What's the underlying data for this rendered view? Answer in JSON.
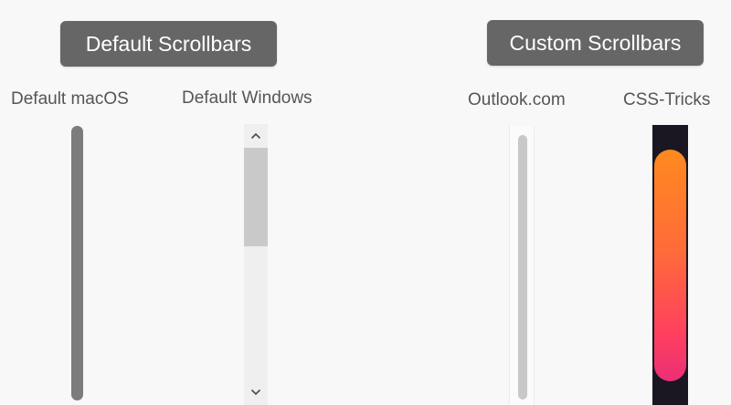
{
  "headings": {
    "default": "Default Scrollbars",
    "custom": "Custom Scrollbars"
  },
  "columns": {
    "macos": "Default macOS",
    "windows": "Default Windows",
    "outlook": "Outlook.com",
    "csstricks": "CSS-Tricks"
  },
  "icons": {
    "windows_up": "chevron-up-icon",
    "windows_down": "chevron-down-icon"
  },
  "colors": {
    "heading_bg": "#666666",
    "macos_thumb": "#7c7c7c",
    "windows_track": "#efefef",
    "windows_thumb": "#c9c9c9",
    "outlook_thumb": "#c8c8c8",
    "csstricks_track": "#1a1722",
    "csstricks_thumb_top": "#ff8a1f",
    "csstricks_thumb_bottom": "#ea2f76"
  },
  "glyphs": {
    "up": "⌃",
    "down": "⌄"
  }
}
